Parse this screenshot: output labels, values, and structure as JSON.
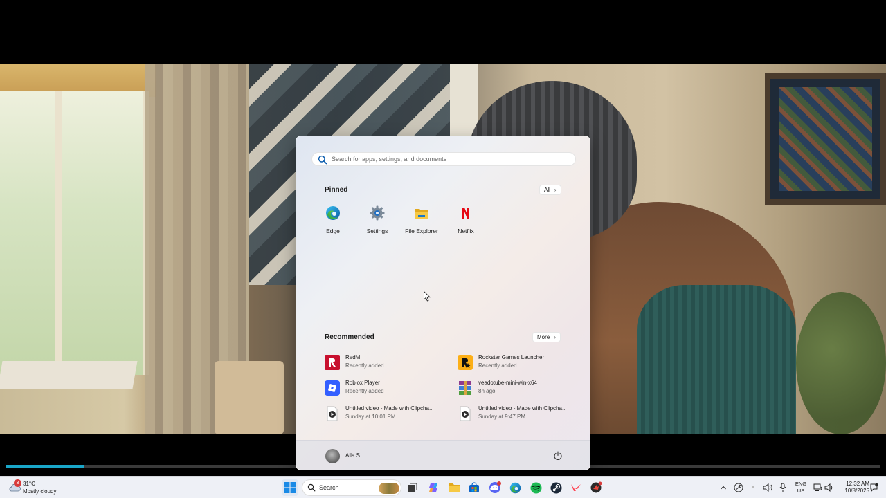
{
  "start_menu": {
    "search": {
      "placeholder": "Search for apps, settings, and documents"
    },
    "pinned": {
      "title": "Pinned",
      "all_label": "All",
      "apps": [
        {
          "label": "Edge",
          "icon": "edge-icon"
        },
        {
          "label": "Settings",
          "icon": "gear-icon"
        },
        {
          "label": "File Explorer",
          "icon": "folder-icon"
        },
        {
          "label": "Netflix",
          "icon": "netflix-icon"
        }
      ]
    },
    "recommended": {
      "title": "Recommended",
      "more_label": "More",
      "items": [
        {
          "name": "RedM",
          "sub": "Recently added",
          "icon": "redm-icon"
        },
        {
          "name": "Rockstar Games Launcher",
          "sub": "Recently added",
          "icon": "rockstar-icon"
        },
        {
          "name": "Roblox Player",
          "sub": "Recently added",
          "icon": "roblox-icon"
        },
        {
          "name": "veadotube-mini-win-x64",
          "sub": "8h ago",
          "icon": "winrar-icon"
        },
        {
          "name": "Untitled video - Made with Clipcha...",
          "sub": "Sunday at 10:01 PM",
          "icon": "video-file-icon"
        },
        {
          "name": "Untitled video - Made with Clipcha...",
          "sub": "Sunday at 9:47 PM",
          "icon": "video-file-icon"
        }
      ]
    },
    "user": {
      "name": "Aila S."
    }
  },
  "taskbar": {
    "weather": {
      "badge": "3",
      "temp": "31°C",
      "condition": "Mostly cloudy"
    },
    "search_label": "Search",
    "apps": [
      "windows-start-icon",
      "task-view-icon",
      "copilot-icon",
      "file-explorer-icon",
      "store-icon",
      "discord-icon",
      "edge-icon",
      "spotify-icon",
      "steam-icon",
      "valorant-icon",
      "riot-client-icon"
    ],
    "tray": {
      "lang_primary": "ENG",
      "lang_secondary": "US",
      "time": "12:32 AM",
      "date": "10/8/2025"
    }
  },
  "video": {
    "progress_fraction": 0.09
  },
  "colors": {
    "accent": "#0078d4",
    "progress": "#19a6c8",
    "badge": "#d83b3b"
  }
}
